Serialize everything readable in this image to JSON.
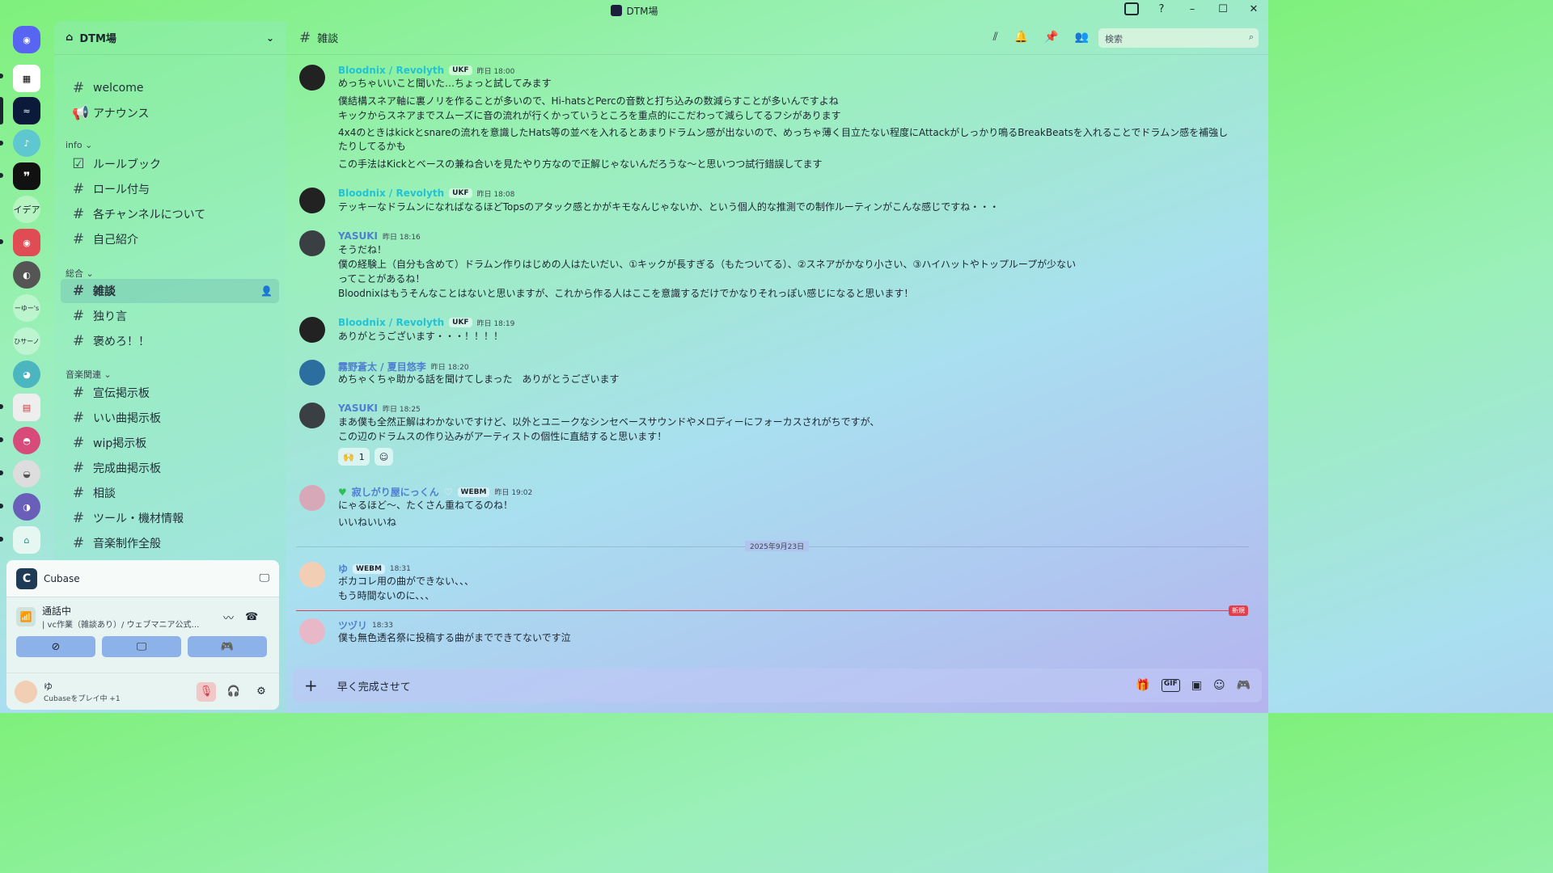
{
  "window": {
    "title": "DTM場"
  },
  "colors": {
    "cyan_name": "#22c3d6",
    "blue_name": "#4f7fd0",
    "teal_name": "#2f9fa3",
    "new_red": "#e0404d"
  },
  "rail": {
    "label_idea": "イデア",
    "label_yu": "ーゆー's",
    "label_saa": "ひサーノ"
  },
  "guild": {
    "name": "DTM場"
  },
  "channels": {
    "top": [
      "welcome",
      "アナウンス"
    ],
    "info_label": "info ⌄",
    "info": [
      "ルールブック",
      "ロール付与",
      "各チャンネルについて",
      "自己紹介"
    ],
    "general_label": "総合 ⌄",
    "general": [
      "雑談",
      "独り言",
      "褒めろ！！"
    ],
    "music_label": "音楽関連 ⌄",
    "music": [
      "宣伝掲示板",
      "いい曲掲示板",
      "wip掲示板",
      "完成曲掲示板",
      "相談",
      "ツール・機材情報",
      "音楽制作全般"
    ]
  },
  "voice": {
    "activity": "Cubase",
    "status": "通話中",
    "channel": "| vc作業（雑談あり）/ ウェブマニア公式…",
    "user_name": "ゆ",
    "user_status": "Cubaseをプレイ中 +1"
  },
  "header": {
    "channel": "雑談",
    "search_placeholder": "検索"
  },
  "messages": [
    {
      "author": "Bloodnix / Revolyth",
      "tag": "UKF",
      "time": "昨日 18:00",
      "lines": [
        "めっちゃいいこと聞いた…ちょっと試してみます",
        "僕結構スネア軸に裏ノリを作ることが多いので、Hi-hatsとPercの音数と打ち込みの数減らすことが多いんですよね",
        "キックからスネアまでスムーズに音の流れが行くかっていうところを重点的にこだわって減らしてるフシがあります",
        "4x4のときはkickとsnareの流れを意識したHats等の並べを入れるとあまりドラムン感が出ないので、めっちゃ薄く目立たない程度にAttackがしっかり鳴るBreakBeatsを入れることでドラムン感を補強したりしてるかも",
        "この手法はKickとベースの兼ね合いを見たやり方なので正解じゃないんだろうな～と思いつつ試行錯誤してます"
      ]
    },
    {
      "author": "Bloodnix / Revolyth",
      "tag": "UKF",
      "time": "昨日 18:08",
      "lines": [
        "テッキーなドラムンになればなるほどTopsのアタック感とかがキモなんじゃないか、という個人的な推測での制作ルーティンがこんな感じですね・・・"
      ]
    },
    {
      "author": "YASUKI",
      "time": "昨日 18:16",
      "lines": [
        "そうだね！",
        "僕の経験上（自分も含めて）ドラムン作りはじめの人はたいだい、①キックが長すぎる（もたついてる）、②スネアがかなり小さい、③ハイハットやトップループが少ない",
        "ってことがあるね！",
        "Bloodnixはもうそんなことはないと思いますが、これから作る人はここを意識するだけでかなりそれっぽい感じになると思います！"
      ]
    },
    {
      "author": "Bloodnix / Revolyth",
      "tag": "UKF",
      "time": "昨日 18:19",
      "lines": [
        "ありがとうございます・・・！！！！"
      ]
    },
    {
      "author": "霧野蒼太 / 夏目悠李",
      "time": "昨日 18:20",
      "lines": [
        "めちゃくちゃ助かる話を聞けてしまった　ありがとうございます"
      ]
    },
    {
      "author": "YASUKI",
      "time": "昨日 18:25",
      "lines": [
        "まあ僕も全然正解はわかないですけど、以外とユニークなシンセベースサウンドやメロディーにフォーカスされがちですが、",
        "この辺のドラムスの作り込みがアーティストの個性に直結すると思います！"
      ],
      "reaction": {
        "emoji": "🙌",
        "count": "1"
      }
    },
    {
      "author": "寂しがり屋にっくん",
      "tag": "WEBM",
      "time": "昨日 19:02",
      "lines": [
        "にゃるほど～、たくさん重ねてるのね！",
        "いいねいいね"
      ]
    },
    {
      "author": "ゆ",
      "tag": "WEBM",
      "time": "18:31",
      "lines": [
        "ボカコレ用の曲ができない、、、",
        "もう時間ないのに、、、"
      ]
    },
    {
      "author": "ツヅリ",
      "time": "18:33",
      "lines": [
        "僕も無色透名祭に投稿する曲がまでできてないです泣"
      ]
    }
  ],
  "date_divider": "2025年9月23日",
  "new_badge": "新規",
  "composer": {
    "text": "早く完成させて"
  }
}
